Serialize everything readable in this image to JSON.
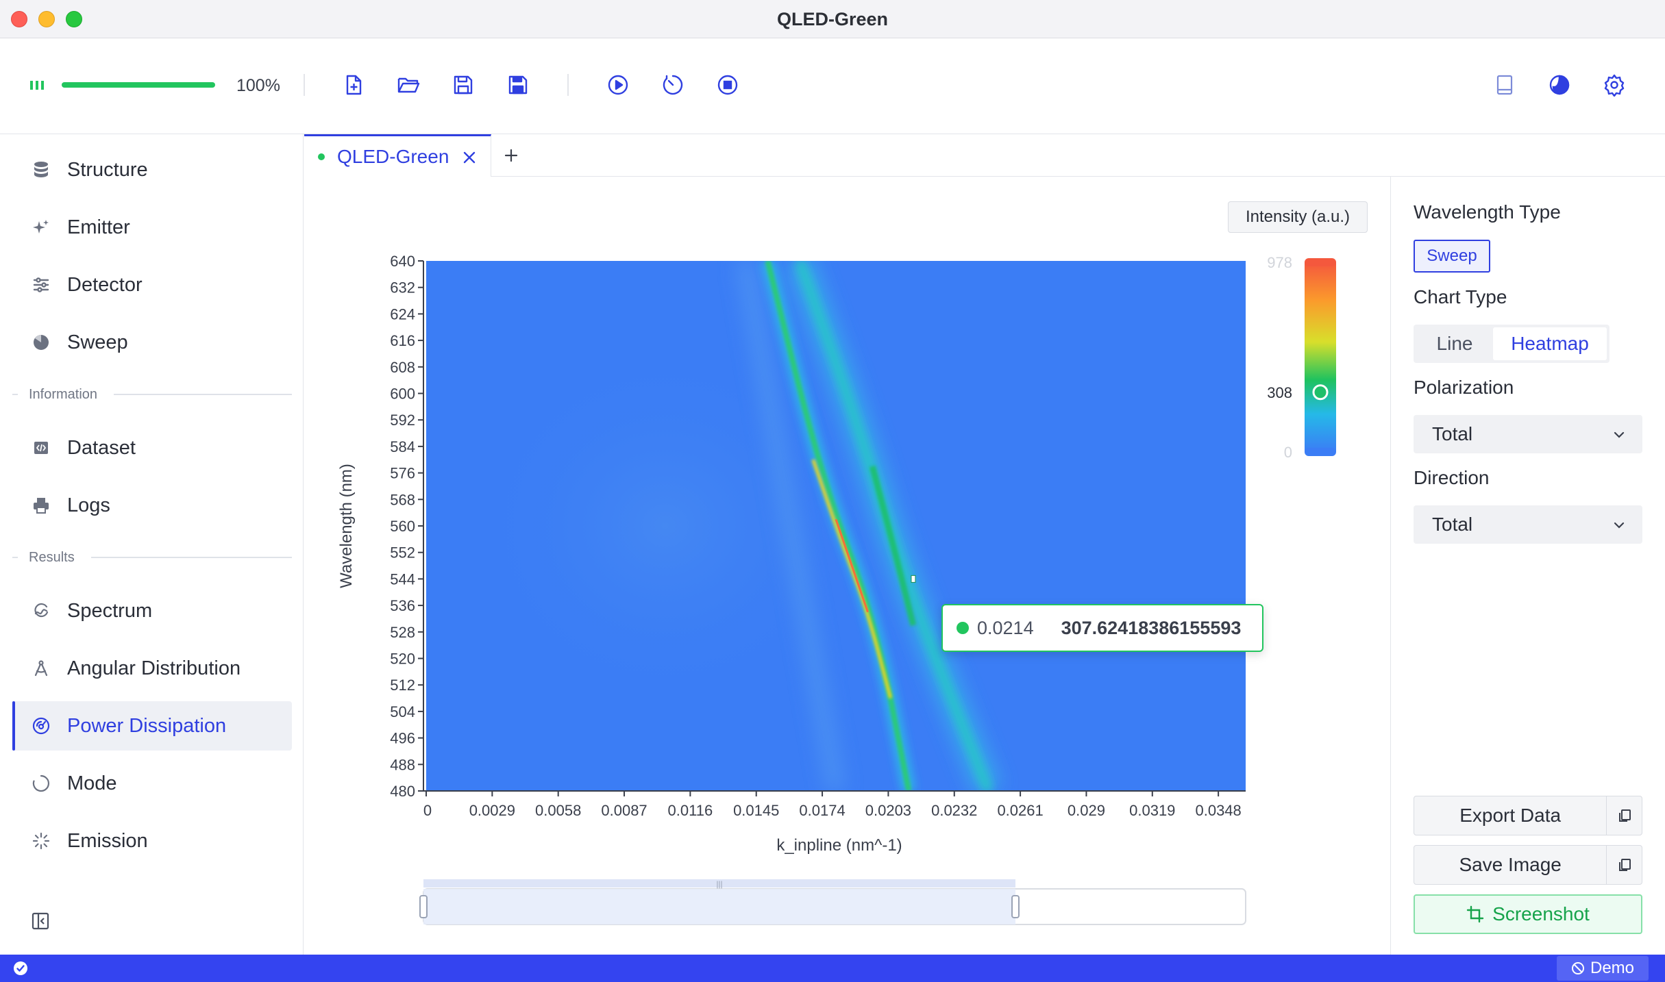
{
  "window": {
    "title": "QLED-Green"
  },
  "toolbar": {
    "progress_text": "100%",
    "progress_value": 1.0
  },
  "sidebar": {
    "items": [
      {
        "label": "Structure",
        "icon": "database-icon"
      },
      {
        "label": "Emitter",
        "icon": "sparkles-icon"
      },
      {
        "label": "Detector",
        "icon": "sliders-icon"
      },
      {
        "label": "Sweep",
        "icon": "pie-icon"
      }
    ],
    "section_information": "Information",
    "info_items": [
      {
        "label": "Dataset",
        "icon": "code-file-icon"
      },
      {
        "label": "Logs",
        "icon": "printer-icon"
      }
    ],
    "section_results": "Results",
    "result_items": [
      {
        "label": "Spectrum",
        "icon": "spectrum-icon"
      },
      {
        "label": "Angular Distribution",
        "icon": "compass-icon"
      },
      {
        "label": "Power Dissipation",
        "icon": "gauge-icon",
        "active": true
      },
      {
        "label": "Mode",
        "icon": "loader-icon"
      },
      {
        "label": "Emission",
        "icon": "burst-icon"
      }
    ]
  },
  "tabs": [
    {
      "label": "QLED-Green",
      "active": true
    }
  ],
  "chart": {
    "intensity_button": "Intensity (a.u.)",
    "tooltip": {
      "x": "0.0214",
      "y": "307.62418386155593"
    }
  },
  "chart_data": {
    "type": "heatmap",
    "xlabel": "k_inpline (nm^-1)",
    "ylabel": "Wavelength (nm)",
    "x_ticks": [
      "0",
      "0.0029",
      "0.0058",
      "0.0087",
      "0.0116",
      "0.0145",
      "0.0174",
      "0.0203",
      "0.0232",
      "0.0261",
      "0.029",
      "0.0319",
      "0.0348"
    ],
    "y_ticks": [
      "480",
      "488",
      "496",
      "504",
      "512",
      "520",
      "528",
      "536",
      "544",
      "552",
      "560",
      "568",
      "576",
      "584",
      "592",
      "600",
      "608",
      "616",
      "624",
      "632",
      "640"
    ],
    "xlim": [
      0,
      0.036
    ],
    "ylim": [
      480,
      640
    ],
    "visual_map": {
      "max_label": "978",
      "min_label": "0",
      "current_label": "308",
      "current_value": 308,
      "min": 0,
      "max": 978
    },
    "zoom_range": [
      0,
      0.72
    ],
    "ridges": [
      {
        "name": "",
        "points": [
          [
            0.015,
            640
          ],
          [
            0.0174,
            574
          ],
          [
            0.0197,
            532
          ],
          [
            0.0212,
            480
          ]
        ],
        "peak": 0.9
      },
      {
        "name": "",
        "points": [
          [
            0.0164,
            640
          ],
          [
            0.019,
            590
          ],
          [
            0.021,
            544
          ],
          [
            0.0247,
            480
          ]
        ],
        "peak": 0.45
      },
      {
        "name": "",
        "points": [
          [
            0.014,
            640
          ],
          [
            0.016,
            560
          ],
          [
            0.018,
            480
          ]
        ],
        "peak": 0.1
      }
    ]
  },
  "right_panel": {
    "wavelength_type_label": "Wavelength Type",
    "sweep_button": "Sweep",
    "chart_type_label": "Chart Type",
    "chart_type_options": [
      "Line",
      "Heatmap"
    ],
    "chart_type_selected": "Heatmap",
    "polarization_label": "Polarization",
    "polarization_value": "Total",
    "direction_label": "Direction",
    "direction_value": "Total",
    "export_data": "Export Data",
    "save_image": "Save Image",
    "screenshot": "Screenshot"
  },
  "statusbar": {
    "demo": "Demo"
  },
  "colors": {
    "accent": "#2f3fe0",
    "success": "#22c55e",
    "statusbar": "#3444f0",
    "heatmap_base": "#3b7df5"
  }
}
